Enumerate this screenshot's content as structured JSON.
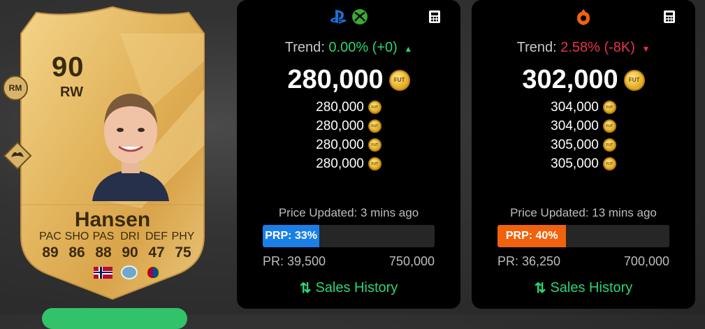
{
  "card": {
    "rating": "90",
    "position": "RW",
    "alt_position": "RM",
    "name": "Hansen",
    "stats": [
      {
        "label": "PAC",
        "value": "89"
      },
      {
        "label": "SHO",
        "value": "86"
      },
      {
        "label": "PAS",
        "value": "88"
      },
      {
        "label": "DRI",
        "value": "90"
      },
      {
        "label": "DEF",
        "value": "47"
      },
      {
        "label": "PHY",
        "value": "75"
      }
    ],
    "nation": "norway-flag",
    "league": "league-badge",
    "club": "barcelona-crest"
  },
  "console_panel": {
    "platforms": [
      "playstation-icon",
      "xbox-icon"
    ],
    "trend_label": "Trend:",
    "trend_value": "0.00% (+0)",
    "trend_direction": "up",
    "price": "280,000",
    "listings": [
      "280,000",
      "280,000",
      "280,000",
      "280,000"
    ],
    "updated": "Price Updated: 3 mins ago",
    "prp_label": "PRP: 33%",
    "prp_fraction": 0.33,
    "pr_min": "PR: 39,500",
    "pr_max": "750,000",
    "sales_label": "Sales History",
    "accent": "#1a7fe6"
  },
  "pc_panel": {
    "platforms": [
      "origin-icon"
    ],
    "trend_label": "Trend:",
    "trend_value": "2.58% (-8K)",
    "trend_direction": "down",
    "price": "302,000",
    "listings": [
      "304,000",
      "304,000",
      "305,000",
      "305,000"
    ],
    "updated": "Price Updated: 13 mins ago",
    "prp_label": "PRP: 40%",
    "prp_fraction": 0.4,
    "pr_min": "PR: 36,250",
    "pr_max": "700,000",
    "sales_label": "Sales History",
    "accent": "#f0620d"
  },
  "colors": {
    "trend_up": "#2bd576",
    "trend_down": "#e8354b",
    "card_gold": "#e2b45c"
  }
}
